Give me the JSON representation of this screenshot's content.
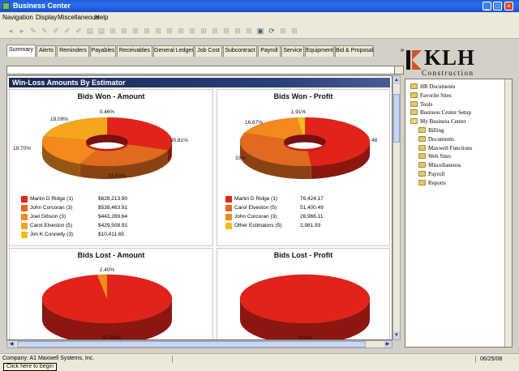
{
  "window": {
    "title": "Business Center"
  },
  "menu": [
    "Navigation",
    "Display",
    "Miscellaneous",
    "Help"
  ],
  "toolbar": {
    "icons": [
      "back-icon",
      "forward-icon",
      "pen-icon",
      "pen-icon",
      "edit-icon",
      "edit-icon",
      "edit-icon",
      "page-icon",
      "page-icon",
      "tool-icon",
      "tool-icon",
      "tool-icon",
      "tool-icon",
      "tool-icon",
      "tool-icon",
      "tool-icon",
      "tool-icon",
      "tool-icon",
      "tool-icon",
      "tool-icon",
      "tool-icon",
      "tool-icon",
      "lock-icon",
      "refresh-icon",
      "tool-icon",
      "tool-icon"
    ]
  },
  "tabs": [
    "Summary",
    "Alerts",
    "Reminders",
    "Payables",
    "Receivables",
    "General Ledger",
    "Job Cost",
    "Subcontract",
    "Payroll",
    "Service",
    "Equipment",
    "Bid & Proposal"
  ],
  "active_tab": "Summary",
  "tab_scroll": "»",
  "section_title": "Win-Loss Amounts By Estimator",
  "colors": {
    "red": "#e2231a",
    "dark_orange": "#e06a1e",
    "orange": "#f28a1e",
    "amber": "#f3a61e",
    "gold": "#f2bb1a"
  },
  "chart_data": [
    {
      "type": "pie",
      "title": "Bids Won - Amount",
      "slices": [
        {
          "label": "Martin D Ridge (1)",
          "value": 628213.9,
          "display": "$628,213.90",
          "percent": 35.81,
          "percent_label": "35.81%",
          "color": "#e2231a"
        },
        {
          "label": "John Corcoran (3)",
          "value": 538463.91,
          "display": "$538,463.91",
          "percent": 23.93,
          "percent_label": "23.93%",
          "color": "#e06a1e"
        },
        {
          "label": "Joel Gibson (3)",
          "value": 443269.84,
          "display": "$443,269.84",
          "percent": 19.7,
          "percent_label": "19.70%",
          "color": "#f28a1e"
        },
        {
          "label": "Carol Elveston (5)",
          "value": 429508.91,
          "display": "$429,508.91",
          "percent": 19.09,
          "percent_label": "19.09%",
          "color": "#f3a61e"
        },
        {
          "label": "Jim K Connelly (3)",
          "value": 10411.65,
          "display": "$10,411.65",
          "percent": 0.46,
          "percent_label": "0.46%",
          "color": "#f2bb1a"
        }
      ]
    },
    {
      "type": "pie",
      "title": "Bids Won - Profit",
      "slices": [
        {
          "label": "Martin D Ridge (1)",
          "value": 76424.17,
          "display": "76,424.17",
          "percent": 48,
          "percent_label": "48",
          "color": "#e2231a"
        },
        {
          "label": "Carol Elveston (5)",
          "value": 51400.49,
          "display": "51,400.49",
          "percent": 33,
          "percent_label": "33%",
          "color": "#e06a1e"
        },
        {
          "label": "John Corcoran (3)",
          "value": 26966.11,
          "display": "26,966.11",
          "percent": 16.67,
          "percent_label": "16.67%",
          "color": "#f28a1e"
        },
        {
          "label": "Other Estimators (5)",
          "value": 2981.93,
          "display": "2,981.93",
          "percent": 1.91,
          "percent_label": "1.91%",
          "color": "#f2bb1a"
        }
      ]
    },
    {
      "type": "pie",
      "title": "Bids Lost - Amount",
      "slices": [
        {
          "label": "",
          "value": 97.6,
          "percent": 97.6,
          "percent_label": "97.60%",
          "color": "#e2231a"
        },
        {
          "label": "",
          "value": 2.4,
          "percent": 2.4,
          "percent_label": "2.40%",
          "color": "#f28a1e"
        }
      ]
    },
    {
      "type": "pie",
      "title": "Bids Lost - Profit",
      "slices": [
        {
          "label": "",
          "value": 100,
          "percent": 100,
          "percent_label": "100%",
          "color": "#e2231a"
        }
      ]
    }
  ],
  "logo": {
    "name": "KLH",
    "sub": "Construction"
  },
  "tree": [
    {
      "label": "HR Documents",
      "level": 0,
      "open": false
    },
    {
      "label": "Favorite Sites",
      "level": 0,
      "open": false
    },
    {
      "label": "Tools",
      "level": 0,
      "open": false
    },
    {
      "label": "Business Center Setup",
      "level": 0,
      "open": false
    },
    {
      "label": "My Business Center",
      "level": 0,
      "open": true
    },
    {
      "label": "Billing",
      "level": 1,
      "open": false
    },
    {
      "label": "Documents",
      "level": 1,
      "open": false
    },
    {
      "label": "Maxwell Functions",
      "level": 1,
      "open": false
    },
    {
      "label": "Web Sites",
      "level": 1,
      "open": false
    },
    {
      "label": "Miscellaneous",
      "level": 1,
      "open": false
    },
    {
      "label": "Payroll",
      "level": 1,
      "open": false
    },
    {
      "label": "Reports",
      "level": 1,
      "open": false
    }
  ],
  "status": {
    "company": "Company: A1 Maxwell Systems, Inc.",
    "date": "06/25/08",
    "begin": "Click here to begin"
  }
}
